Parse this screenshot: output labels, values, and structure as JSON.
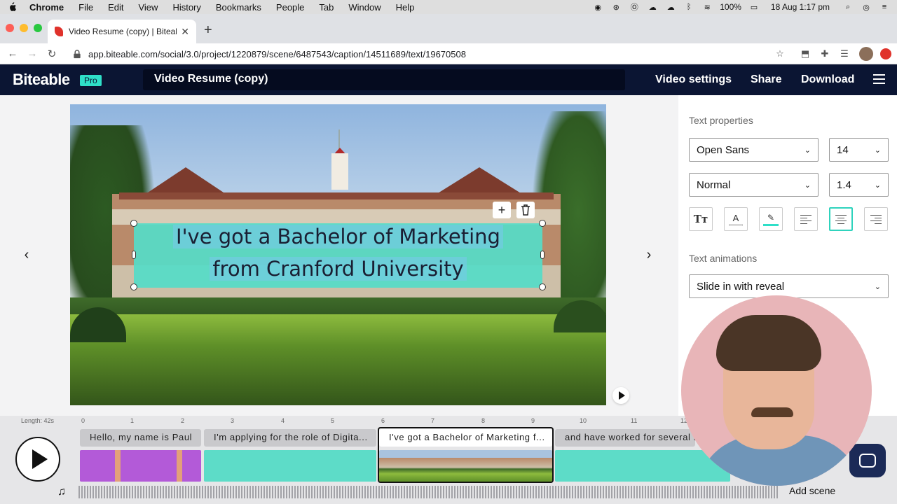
{
  "menubar": {
    "app": "Chrome",
    "items": [
      "File",
      "Edit",
      "View",
      "History",
      "Bookmarks",
      "People",
      "Tab",
      "Window",
      "Help"
    ],
    "battery": "100%",
    "datetime": "18 Aug  1:17 pm"
  },
  "browser": {
    "tab_title": "Video Resume (copy) | Biteable",
    "url": "app.biteable.com/social/3.0/project/1220879/scene/6487543/caption/14511689/text/19670508"
  },
  "app": {
    "logo": "Biteable",
    "badge": "Pro",
    "project_title": "Video Resume (copy)",
    "nav": {
      "video_settings": "Video settings",
      "share": "Share",
      "download": "Download"
    }
  },
  "caption": {
    "line1": "I've got a Bachelor of Marketing",
    "line2": "from Cranford University"
  },
  "panel": {
    "text_properties_heading": "Text properties",
    "font": "Open Sans",
    "font_size": "14",
    "weight": "Normal",
    "line_height": "1.4",
    "text_animations_heading": "Text animations",
    "animation": "Slide in with reveal"
  },
  "timeline": {
    "length": "Length: 42s",
    "ticks": [
      "0",
      "1",
      "2",
      "3",
      "4",
      "5",
      "6",
      "7",
      "8",
      "9",
      "10",
      "11",
      "12"
    ],
    "clips": [
      "Hello, my name is Paul",
      "I'm applying for the role of Digita...",
      "I've got a Bachelor of Marketing f...",
      "and have worked for several m"
    ],
    "add_scene": "Add scene"
  },
  "colors": {
    "header_bg": "#0b1533",
    "accent": "#2fdfc8",
    "caption_bg": "#55dcc8"
  }
}
